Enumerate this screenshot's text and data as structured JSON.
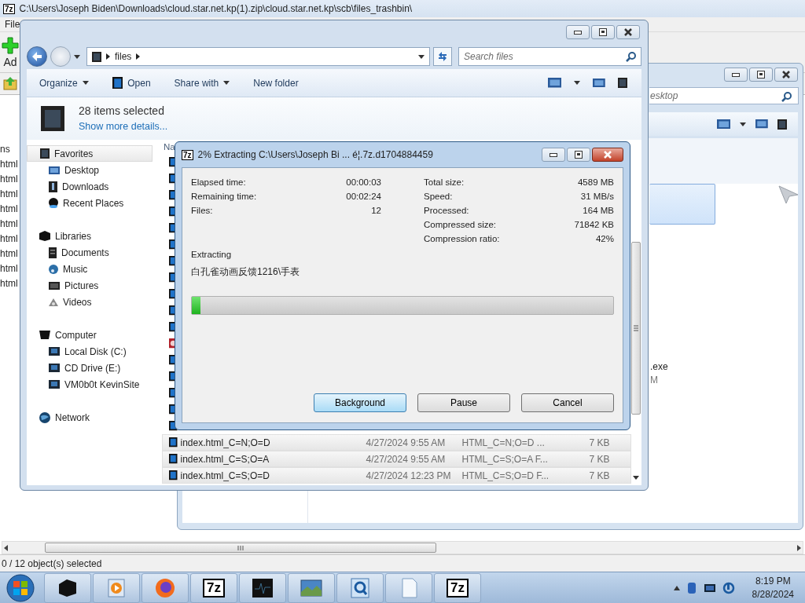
{
  "file_manager": {
    "icon_label": "7z",
    "title": "C:\\Users\\Joseph Biden\\Downloads\\cloud.star.net.kp(1).zip\\cloud.star.net.kp\\scb\\files_trashbin\\",
    "menu": [
      "File"
    ],
    "toolbar": [
      "Ad"
    ],
    "list_items": [
      "ns",
      "html",
      "html",
      "html",
      "html",
      "html",
      "html",
      "html",
      "html",
      "html"
    ],
    "status": "0 / 12 object(s) selected"
  },
  "desktop_window": {
    "search_placeholder": "esktop",
    "items": [
      ".exe",
      "M"
    ]
  },
  "explorer": {
    "breadcrumb": [
      "files"
    ],
    "search_placeholder": "Search files",
    "toolbar": [
      {
        "label": "Organize",
        "dropdown": true
      },
      {
        "label": "Open",
        "dropdown": false
      },
      {
        "label": "Share with",
        "dropdown": true
      },
      {
        "label": "New folder",
        "dropdown": false
      }
    ],
    "details": {
      "summary": "28 items selected",
      "link": "Show more details..."
    },
    "nav": [
      {
        "label": "Favorites",
        "selected": true,
        "children": [
          {
            "label": "Desktop",
            "selected": false
          },
          {
            "label": "Downloads",
            "selected": false
          },
          {
            "label": "Recent Places",
            "selected": false
          }
        ]
      },
      {
        "label": "Libraries",
        "selected": false,
        "children": [
          {
            "label": "Documents",
            "selected": false
          },
          {
            "label": "Music",
            "selected": false
          },
          {
            "label": "Pictures",
            "selected": false
          },
          {
            "label": "Videos",
            "selected": false
          }
        ]
      },
      {
        "label": "Computer",
        "selected": false,
        "children": [
          {
            "label": "Local Disk (C:)",
            "selected": false
          },
          {
            "label": "CD Drive (E:)",
            "selected": false
          },
          {
            "label": "VM0b0t KevinSite",
            "selected": false
          }
        ]
      },
      {
        "label": "Network",
        "selected": false
      }
    ],
    "column_header": "Na",
    "rows": [
      {
        "name": "index.html_C=N;O=D",
        "date": "4/27/2024 9:55 AM",
        "type": "HTML_C=N;O=D ...",
        "size": "7 KB",
        "selected": true
      },
      {
        "name": "index.html_C=S;O=A",
        "date": "4/27/2024 9:55 AM",
        "type": "HTML_C=S;O=A F...",
        "size": "7 KB",
        "selected": true
      },
      {
        "name": "index.html_C=S;O=D",
        "date": "4/27/2024 12:23 PM",
        "type": "HTML_C=S;O=D F...",
        "size": "7 KB",
        "selected": true
      }
    ]
  },
  "dialog": {
    "icon_label": "7z",
    "title": "2% Extracting C:\\Users\\Joseph Bi ... é¦.7z.d1704884459",
    "stats_left": [
      {
        "label": "Elapsed time:",
        "value": "00:00:03"
      },
      {
        "label": "Remaining time:",
        "value": "00:02:24"
      },
      {
        "label": "Files:",
        "value": "12"
      }
    ],
    "stats_right": [
      {
        "label": "Total size:",
        "value": "4589 MB"
      },
      {
        "label": "Speed:",
        "value": "31 MB/s"
      },
      {
        "label": "Processed:",
        "value": "164 MB"
      },
      {
        "label": "Compressed size:",
        "value": "71842 KB"
      },
      {
        "label": "Compression ratio:",
        "value": "42%"
      }
    ],
    "operation": "Extracting",
    "current_file": "白孔雀动画反馈1216\\手表",
    "progress": {
      "level": 0.02
    },
    "buttons": [
      {
        "label": "Background",
        "default": true
      },
      {
        "label": "Pause",
        "default": false
      },
      {
        "label": "Cancel",
        "default": false
      }
    ]
  },
  "taskbar": {
    "apps": [
      {
        "kind": "box"
      },
      {
        "kind": "media"
      },
      {
        "kind": "browser"
      },
      {
        "kind": "sevenzip",
        "label": "7z"
      },
      {
        "kind": "monitor"
      },
      {
        "kind": "photo"
      },
      {
        "kind": "search"
      },
      {
        "kind": "document"
      },
      {
        "kind": "sevenzip",
        "label": "7z"
      }
    ],
    "time": "8:19 PM",
    "date": "8/28/2024"
  }
}
